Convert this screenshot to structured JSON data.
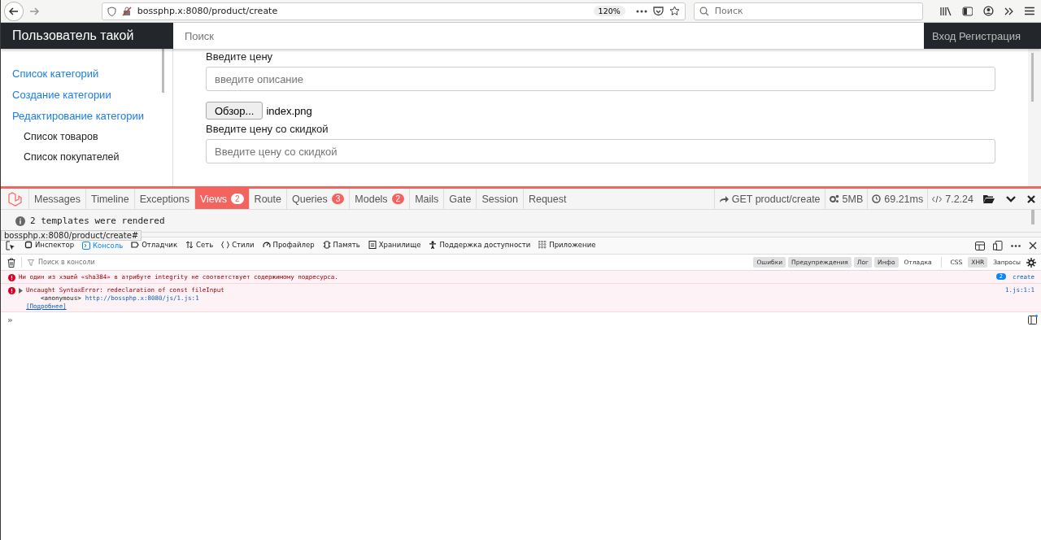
{
  "browser": {
    "url": "bossphp.x:8080/product/create",
    "zoom": "120%",
    "search_placeholder": "Поиск"
  },
  "navbar": {
    "brand": "Пользователь такой",
    "search_placeholder": "Поиск",
    "auth": "Вход Регистрация"
  },
  "sidebar": {
    "items": [
      {
        "label": "Список категорий",
        "kind": "link"
      },
      {
        "label": "Создание категории",
        "kind": "link"
      },
      {
        "label": "Редактирование категории",
        "kind": "link"
      },
      {
        "label": "Список товаров",
        "kind": "sub"
      },
      {
        "label": "Список покупателей",
        "kind": "sub"
      }
    ]
  },
  "form": {
    "price_label": "Введите цену",
    "description_placeholder": "введите описание",
    "browse_button": "Обзор...",
    "file_name": "index.png",
    "discount_label": "Введите цену со скидкой",
    "discount_placeholder": "Введите цену со скидкой"
  },
  "debugbar": {
    "tabs": [
      {
        "label": "Messages",
        "selected": false
      },
      {
        "label": "Timeline",
        "selected": false
      },
      {
        "label": "Exceptions",
        "selected": false
      },
      {
        "label": "Views",
        "badge": "2",
        "selected": true
      },
      {
        "label": "Route",
        "selected": false
      },
      {
        "label": "Queries",
        "badge": "3",
        "selected": false
      },
      {
        "label": "Models",
        "badge": "2",
        "selected": false
      },
      {
        "label": "Mails",
        "selected": false
      },
      {
        "label": "Gate",
        "selected": false
      },
      {
        "label": "Session",
        "selected": false
      },
      {
        "label": "Request",
        "selected": false
      }
    ],
    "route": "GET product/create",
    "memory": "5MB",
    "time": "69.21ms",
    "version": "7.2.24",
    "message": "2 templates were rendered"
  },
  "status_url": "bossphp.x:8080/product/create#",
  "devtools": {
    "tabs": [
      {
        "label": "Инспектор",
        "selected": false
      },
      {
        "label": "Консоль",
        "selected": true
      },
      {
        "label": "Отладчик",
        "selected": false
      },
      {
        "label": "Сеть",
        "selected": false
      },
      {
        "label": "Стили",
        "selected": false
      },
      {
        "label": "Профайлер",
        "selected": false
      },
      {
        "label": "Память",
        "selected": false
      },
      {
        "label": "Хранилище",
        "selected": false
      },
      {
        "label": "Поддержка доступности",
        "selected": false
      },
      {
        "label": "Приложение",
        "selected": false
      }
    ],
    "filter_placeholder": "Поиск в консоли",
    "filters": [
      {
        "label": "Ошибки",
        "on": true
      },
      {
        "label": "Предупреждения",
        "on": true
      },
      {
        "label": "Лог",
        "on": true
      },
      {
        "label": "Инфо",
        "on": true
      },
      {
        "label": "Отладка",
        "on": false
      }
    ],
    "net_filters": [
      {
        "label": "CSS",
        "on": false
      },
      {
        "label": "XHR",
        "on": true
      },
      {
        "label": "Запросы",
        "on": false
      }
    ],
    "messages": [
      {
        "text": "Ни один из хэшей «sha384» в атрибуте integrity не соответствует содержимому подресурса.",
        "count": "2",
        "source": "create"
      },
      {
        "text": "Uncaught SyntaxError: redeclaration of const fileInput",
        "expandable": true,
        "frame": "<anonymous>",
        "frame_link": "http://bossphp.x:8080/js/1.js:1",
        "more": "[Подробнее]",
        "source": "1.js:1:1"
      }
    ],
    "prompt": "»"
  }
}
